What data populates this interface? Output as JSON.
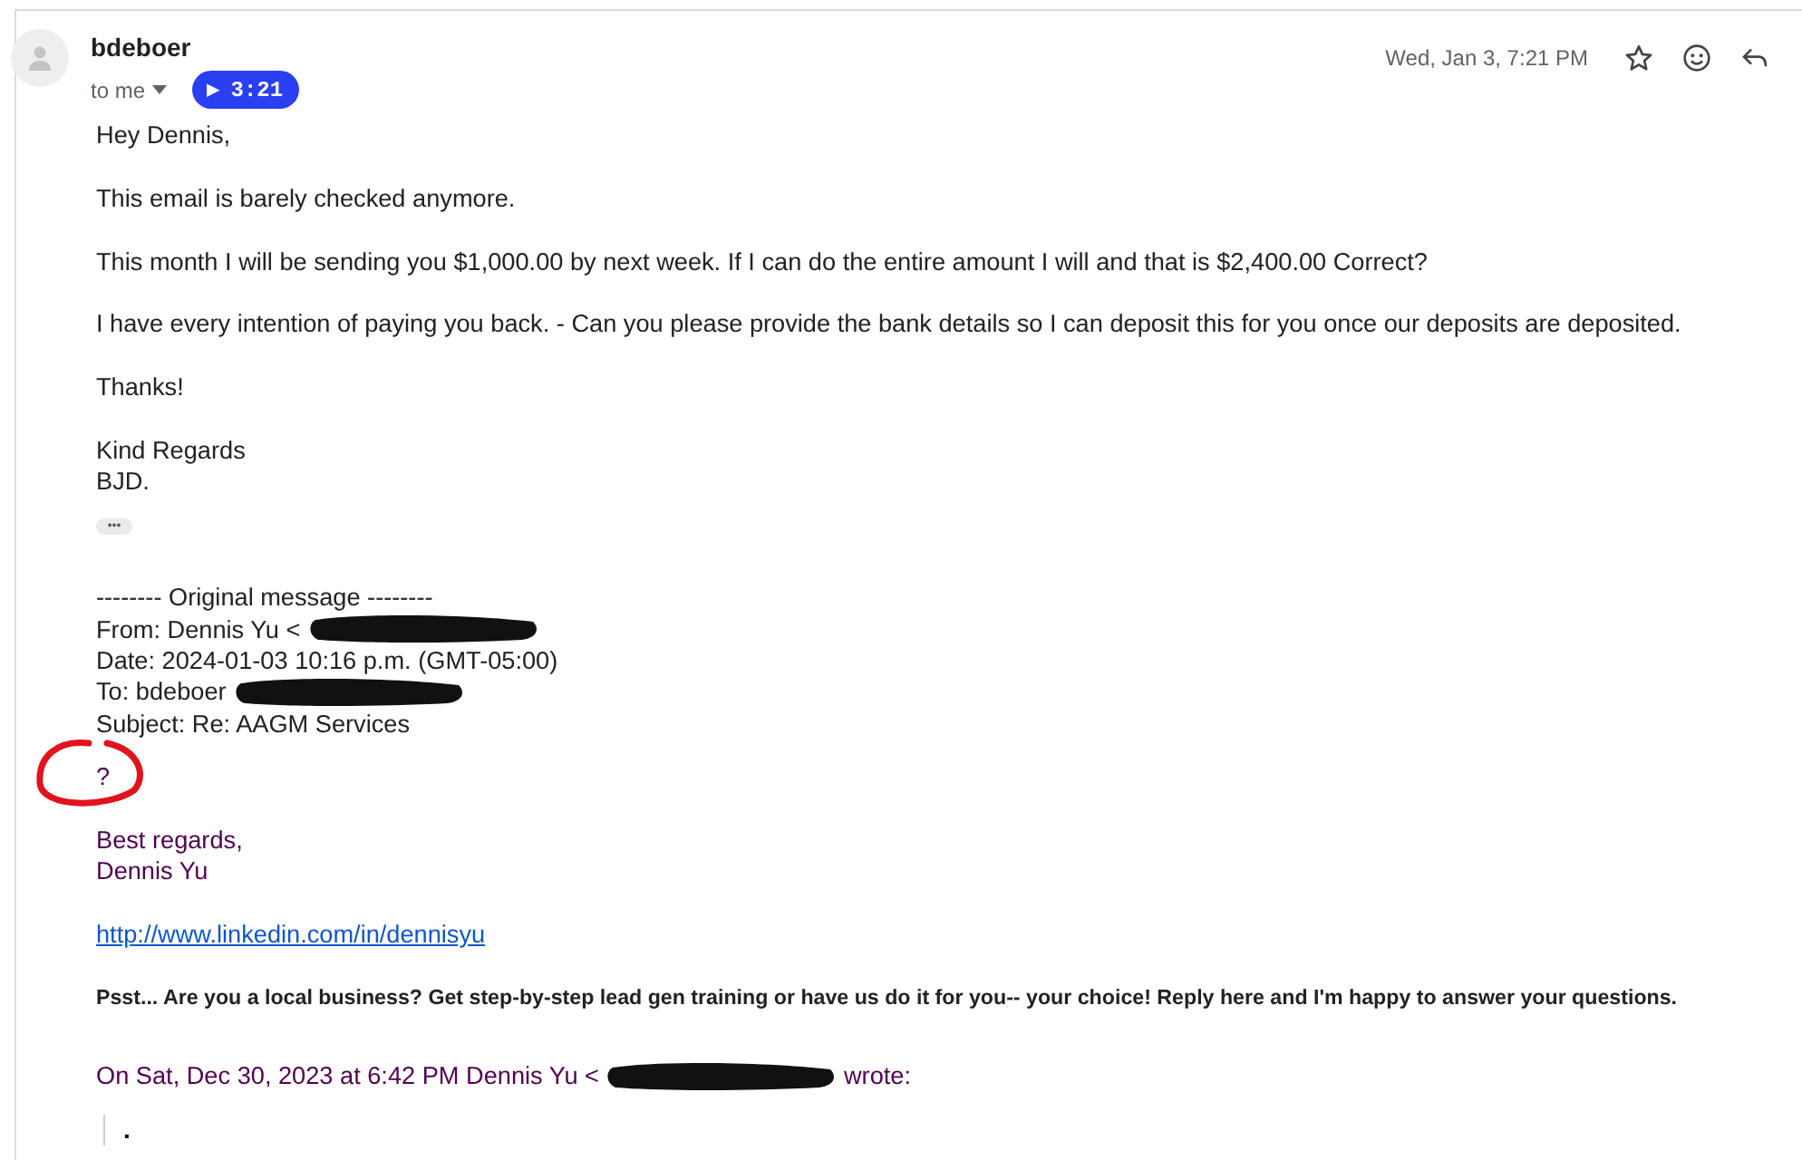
{
  "header": {
    "sender": "bdeboer",
    "recipient": "to me",
    "audio_badge": {
      "icon": "▶",
      "duration": "3:21"
    },
    "date": "Wed, Jan 3, 7:21 PM"
  },
  "body": [
    {
      "kind": "para",
      "lines": [
        {
          "text": "Hey Dennis,",
          "kind": "plain",
          "redacted": false
        }
      ]
    },
    {
      "kind": "para",
      "lines": [
        {
          "text": "This email is barely checked anymore.",
          "kind": "plain",
          "redacted": false
        }
      ]
    },
    {
      "kind": "para",
      "lines": [
        {
          "text": "This month I will be sending you $1,000.00 by next week. If I can do the entire amount I will and that is $2,400.00 Correct?",
          "kind": "plain",
          "redacted": false
        }
      ]
    },
    {
      "kind": "para",
      "lines": [
        {
          "text": "I have every intention of paying you back. - Can you please provide the bank details so I can deposit this for you once our deposits are deposited.",
          "kind": "plain",
          "redacted": false
        }
      ]
    },
    {
      "kind": "para",
      "lines": [
        {
          "text": "Thanks!",
          "kind": "plain",
          "redacted": false
        }
      ]
    },
    {
      "kind": "para",
      "lines": [
        {
          "text": "Kind Regards",
          "kind": "plain",
          "redacted": false
        },
        {
          "text": "BJD.",
          "kind": "plain",
          "redacted": false
        }
      ]
    },
    {
      "kind": "trimmed",
      "label": "•••"
    },
    {
      "kind": "section",
      "lines": [
        {
          "text": "-------- Original message --------",
          "kind": "plain",
          "redacted": false
        },
        {
          "text": "From: Dennis Yu <",
          "kind": "plain",
          "redacted": true
        },
        {
          "text": "Date: 2024-01-03 10:16 p.m. (GMT-05:00)",
          "kind": "plain",
          "redacted": false
        },
        {
          "text": "To: bdeboer",
          "kind": "plain",
          "redacted": true
        },
        {
          "text": "Subject: Re: AAGM Services",
          "kind": "plain",
          "redacted": false
        }
      ]
    },
    {
      "kind": "circled",
      "lines": [
        {
          "text": "?",
          "kind": "quoted",
          "redacted": false
        }
      ]
    },
    {
      "kind": "para",
      "lines": [
        {
          "text": "Best regards,",
          "kind": "quoted",
          "redacted": false
        },
        {
          "text": "Dennis Yu",
          "kind": "quoted",
          "redacted": false
        }
      ]
    },
    {
      "kind": "para",
      "lines": [
        {
          "text": "http://www.linkedin.com/in/dennisyu",
          "kind": "link",
          "redacted": false
        }
      ]
    },
    {
      "kind": "para",
      "lines": [
        {
          "text": "Psst... Are you a local business? Get step-by-step lead gen training or have us do it for you-- your choice!  Reply here and I'm happy to answer your questions.",
          "kind": "bold",
          "redacted": false
        }
      ]
    },
    {
      "kind": "section",
      "lines": [
        {
          "text": "On Sat, Dec 30, 2023 at 6:42 PM Dennis Yu <",
          "kind": "quoted",
          "redacted": true,
          "after": "wrote:"
        }
      ]
    },
    {
      "kind": "quote",
      "lines": [
        {
          "text": ".",
          "kind": "dot",
          "redacted": false
        }
      ]
    }
  ]
}
